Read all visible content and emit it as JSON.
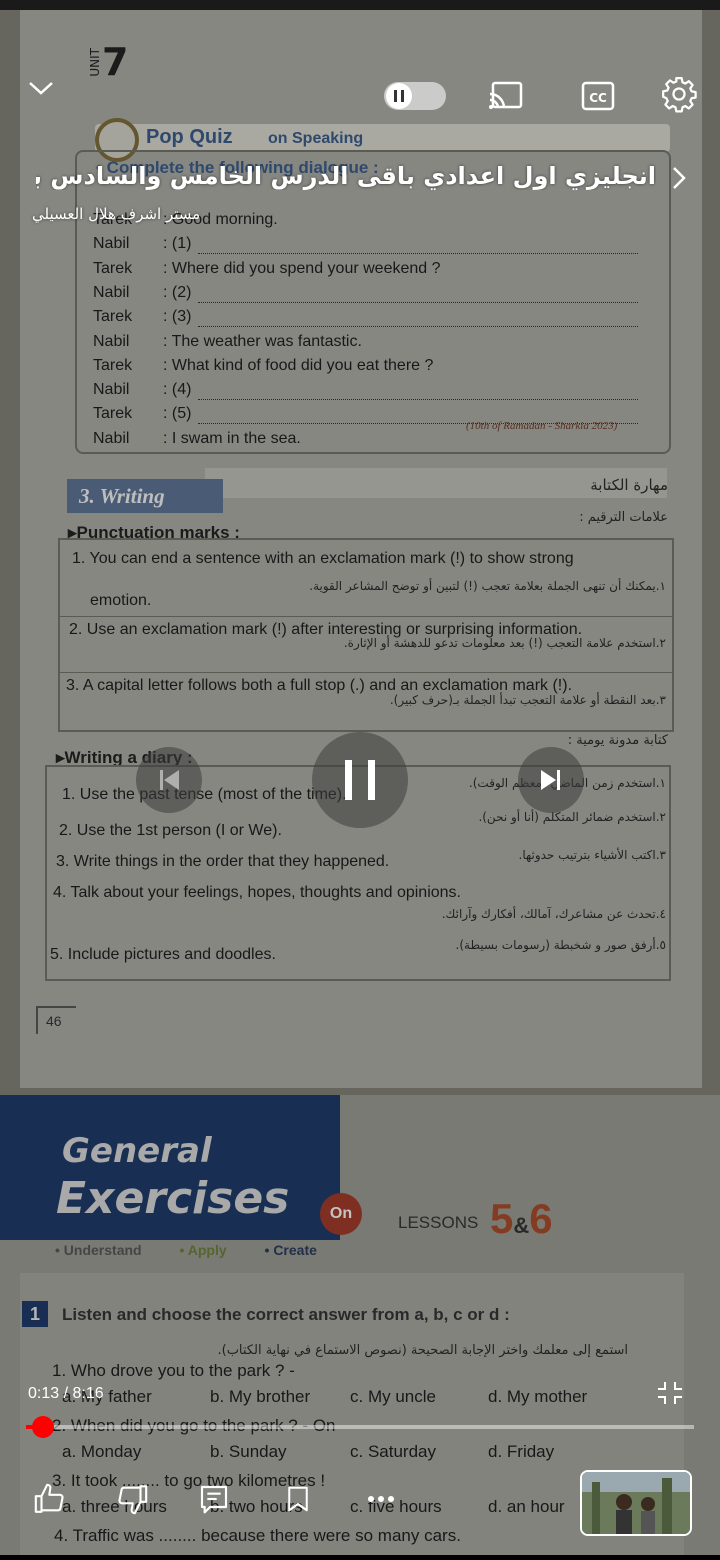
{
  "player": {
    "video_title": "انجليزي اول اعدادي باقى الدرس الخامس والسادس بعد الت",
    "channel": "مستر اشرف هلال العسيلي",
    "time_current": "0:13",
    "time_separator": " / ",
    "time_total": "8:16",
    "progress_fraction": 0.026,
    "autoplay_on": false
  },
  "page1": {
    "unit_label": "UNIT",
    "unit_number": "7",
    "quiz_title": "Pop Quiz",
    "quiz_subtitle": "on Speaking",
    "complete_instruction": "• Complete the following dialogue :",
    "dialogue": [
      {
        "speaker": "Tarek",
        "line": ": Good morning."
      },
      {
        "speaker": "Nabil",
        "line": ": (1)"
      },
      {
        "speaker": "Tarek",
        "line": ": Where did you spend your weekend ?"
      },
      {
        "speaker": "Nabil",
        "line": ": (2)"
      },
      {
        "speaker": "Tarek",
        "line": ": (3)"
      },
      {
        "speaker": "Nabil",
        "line": ": The weather was fantastic."
      },
      {
        "speaker": "Tarek",
        "line": ": What kind of food did you eat there ?"
      },
      {
        "speaker": "Nabil",
        "line": ": (4)"
      },
      {
        "speaker": "Tarek",
        "line": ": (5)"
      },
      {
        "speaker": "Nabil",
        "line": ": I swam in the sea."
      }
    ],
    "reference": "(10th of Ramadan - Sharkia 2023)",
    "writing_title": "Writing",
    "writing_number": "3.",
    "writing_ar": "مهارة الكتابة",
    "punctuation_title": "Punctuation marks :",
    "punctuation_ar": "علامات الترقيم :",
    "punctuation_rules": [
      {
        "en": "1. You can end a sentence with an exclamation mark (!) to show strong",
        "en2": "emotion.",
        "ar": "١.يمكنك أن تنهى الجملة بعلامة تعجب (!) لتبين أو توضح المشاعر القوية."
      },
      {
        "en": "2. Use an exclamation mark (!) after interesting or surprising information.",
        "ar": "٢.استخدم علامة التعجب (!) بعد معلومات تدعو للدهشة أو الإثارة."
      },
      {
        "en": "3. A capital letter follows both a full stop (.) and an exclamation mark (!).",
        "ar": "٣.بعد النقطة أو علامة التعجب تبدأ الجملة بـ(حرف كبير)."
      }
    ],
    "diary_title": "Writing a diary :",
    "diary_ar": "كتابة مدونة يومية :",
    "diary_rules": [
      {
        "en": "1. Use the past tense (most of the time).",
        "ar": "١.استخدم زمن الماضي (معظم الوقت)."
      },
      {
        "en": "2. Use the 1st person (I or We).",
        "ar": "٢.استخدم ضمائر المتكلم (أنا أو نحن)."
      },
      {
        "en": "3. Write things in the order that they happened.",
        "ar": "٣.اكتب الأشياء بترتيب حدوثها."
      },
      {
        "en": "4. Talk about your feelings, hopes, thoughts and opinions.",
        "ar": "٤.تحدث عن مشاعرك، آمالك، أفكارك وآرائك."
      },
      {
        "en": "5. Include pictures and doodles.",
        "ar": "٥.أرفق صور و شخبطة (رسومات بسيطة)."
      }
    ],
    "page_number": "46"
  },
  "page2": {
    "general": "General",
    "exercises": "Exercises",
    "on": "On",
    "lessons_label": "LESSONS",
    "lesson_a": "5",
    "amp": "&",
    "lesson_b": "6",
    "tags": [
      "• Understand",
      "• Apply",
      "• Create"
    ],
    "ex_number": "1",
    "ex_title": "Listen and choose the correct answer from a, b, c or d :",
    "ex_ar": "استمع إلى معلمك واختر الإجابة الصحيحة (نصوص الاستماع في نهاية الكتاب).",
    "questions": [
      {
        "q": "1. Who drove you to the park ? -",
        "opts": [
          "a. My father",
          "b. My brother",
          "c. My uncle",
          "d. My mother"
        ]
      },
      {
        "q": "2. When did you go to the park ? - On",
        "opts": [
          "a. Monday",
          "b. Sunday",
          "c. Saturday",
          "d. Friday"
        ]
      },
      {
        "q": "3. It took ........ to go two kilometres !",
        "opts": [
          "a. three hours",
          "b. two hours",
          "c. five hours",
          "d. an hour"
        ]
      },
      {
        "q": "4. Traffic was ........ because there were so many cars.",
        "opts": []
      }
    ]
  },
  "icons": [
    "chevron-down-icon",
    "pause-icon",
    "cast-icon",
    "cc-icon",
    "gear-icon",
    "previous-icon",
    "next-icon",
    "fullscreen-exit-icon",
    "like-icon",
    "dislike-icon",
    "comment-icon",
    "save-icon",
    "more-icon"
  ],
  "colors": {
    "accent": "#ff0000",
    "overlay_text": "#ffffff"
  }
}
